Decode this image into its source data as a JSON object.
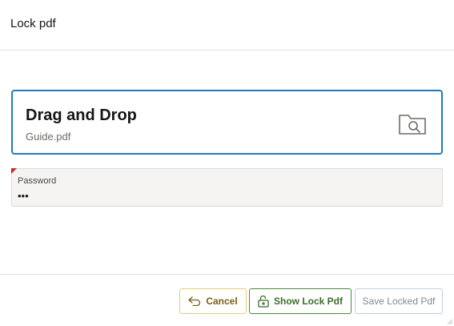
{
  "dialog": {
    "title": "Lock pdf"
  },
  "dropzone": {
    "heading": "Drag and Drop",
    "file_name": "Guide.pdf",
    "icon": "folder-search-icon"
  },
  "password": {
    "label": "Password",
    "value": "•••",
    "required": true
  },
  "footer": {
    "cancel_label": "Cancel",
    "cancel_icon": "undo-arrow-icon",
    "show_label": "Show Lock Pdf",
    "show_icon": "unlock-icon",
    "save_label": "Save Locked Pdf"
  },
  "colors": {
    "accent": "#227bbd",
    "required": "#d6212a",
    "cancel_border": "#e7cf72",
    "show_border": "#4a8a3a"
  }
}
